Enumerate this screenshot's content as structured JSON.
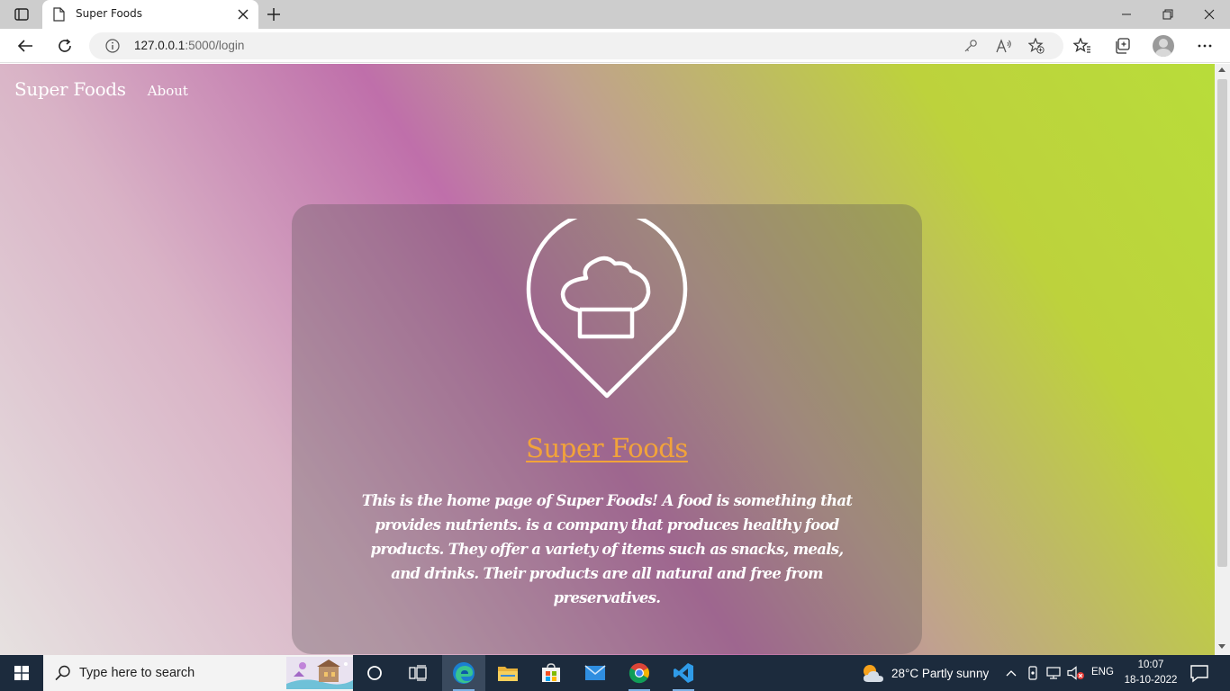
{
  "browser": {
    "tab_title": "Super Foods",
    "url_host": "127.0.0.1",
    "url_path": ":5000/login"
  },
  "page": {
    "nav": {
      "brand": "Super Foods",
      "about": "About"
    },
    "card": {
      "title": "Super Foods",
      "description": "This is the home page of Super Foods! A food is something that provides nutrients. is a company that produces healthy food products. They offer a variety of items such as snacks, meals, and drinks. Their products are all natural and free from preservatives.",
      "logo_icon": "chef-hat-location-pin-icon"
    },
    "colors": {
      "title_link": "#f2a33a",
      "gradient": [
        "#e6e1e0",
        "#d9b3c6",
        "#bf6faa",
        "#c0a090",
        "#bdd23c",
        "#b8dd3a"
      ]
    }
  },
  "taskbar": {
    "search_placeholder": "Type here to search",
    "apps": [
      "task-view",
      "edge",
      "file-explorer",
      "microsoft-store",
      "mail",
      "chrome",
      "vscode"
    ],
    "weather": "28°C  Partly sunny",
    "language": "ENG",
    "time": "10:07",
    "date": "18-10-2022"
  }
}
